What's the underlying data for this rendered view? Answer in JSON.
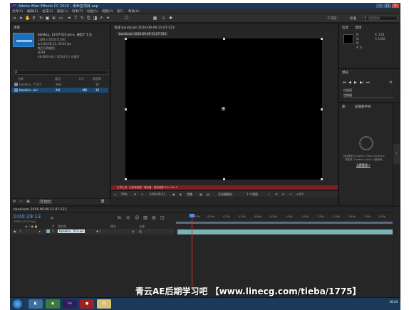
{
  "window": {
    "title": "Adobe After Effects CC 2015 - 未命名项目.aep",
    "app_icon_label": "Ae"
  },
  "menu": [
    "文件(F)",
    "编辑(E)",
    "合成(C)",
    "图层(L)",
    "效果(T)",
    "动画(A)",
    "视图(V)",
    "窗口",
    "帮助(H)"
  ],
  "toolbar": {
    "workspace_label": "工作区:",
    "workspace_value": "标准",
    "search_placeholder": "搜索帮助"
  },
  "project": {
    "tab": "项目",
    "item_name": "bandica...11-07-523.avi ▾，使用了 1 次",
    "meta": [
      "1280 x 1024 (1.00)",
      "Δ 0;00;29;12, 30.00 fps",
      "数百万种颜色",
      "H264",
      "48.000 kHz / 16 bit U / 立体声"
    ],
    "search_placeholder": "ρ.",
    "columns": [
      "名称",
      "类型",
      "大小",
      "帧速率"
    ],
    "files": [
      {
        "name": "bandica...7-523",
        "type": "合成",
        "size": "",
        "fps": "30"
      },
      {
        "name": "bandica...avi",
        "type": "AVI",
        "size": "...MB",
        "fps": "30"
      }
    ],
    "bpc": "8 bpc"
  },
  "composition": {
    "tab": "合成 bandicam 2016-09-09 11-07-523",
    "subtab": "bandicam 2016-09-09 11-07-523",
    "warning": "已停止用 ' 当前渲染器 ' 渲染器，渲染帧数 Zero Hsl S",
    "zoom": "50%",
    "timecode": "0;00;29;13",
    "quality": "完整",
    "camera": "活动摄像机",
    "views": "1 个视图",
    "offset": "+0.0"
  },
  "info": {
    "tabs": [
      "信息",
      "音频"
    ],
    "rgb": [
      "R:",
      "G:",
      "B:",
      "A: 0"
    ],
    "xy": [
      "X: 128",
      "Y: 1036"
    ]
  },
  "preview": {
    "tab": "预览",
    "shortcut_label": "快捷键",
    "shortcut_value": "空格键"
  },
  "libraries": {
    "tabs": [
      "库",
      "段落和字符"
    ],
    "message_lines": [
      "欢迎使用 Creative Cloud Libraries。",
      "请登录 Creative Cloud 以使用库。"
    ],
    "link": "立即登录 »"
  },
  "timeline": {
    "tab": "bandicam 2016-09-09 11-07-523",
    "timecode": "0:00:29:13",
    "timecode_sub": "00883 (30.00 fps)",
    "search_placeholder": "ρ.",
    "ruler": [
      "0:00s",
      "0:10s",
      "0:20s",
      "0:30s",
      "0:40s",
      "0:50s",
      "1:00s",
      "1:10s",
      "1:20s",
      "1:30s",
      "1:40s",
      "1:50s",
      "2:00s"
    ],
    "columns": [
      "#",
      "源名称",
      "模式",
      "父级"
    ],
    "layer": {
      "index": "1",
      "name": "bandica...523.avi",
      "parent": "无"
    }
  },
  "watermark": "青云AE后期学习吧 【www.linecg.com/tieba/1775】",
  "taskbar": {
    "apps": [
      "",
      "",
      "Ae",
      "",
      ""
    ],
    "time": "16:44"
  }
}
